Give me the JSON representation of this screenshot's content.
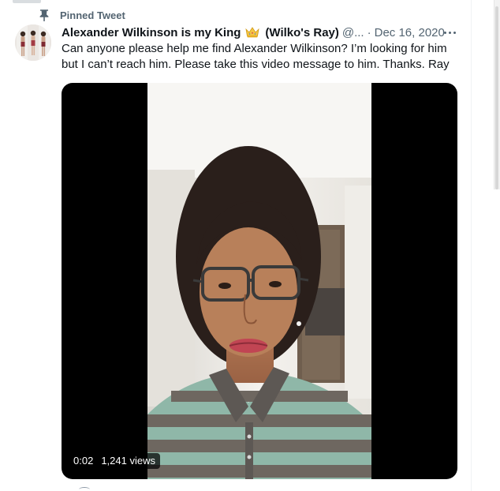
{
  "pinned": {
    "label": "Pinned Tweet",
    "icon": "pin-icon"
  },
  "tweet": {
    "display_name": "Alexander Wilkinson is my King",
    "display_name_emoji": "crown-icon",
    "display_name_tail": "(Wilko's Ray)",
    "handle": "@...",
    "separator": "·",
    "date": "Dec 16, 2020",
    "text_lines": [
      "Can anyone please help me find Alexander Wilkinson? I’m looking for him",
      "but I can’t reach him. Please take this video message to him. Thanks. Ray"
    ],
    "more_icon": "more-horizontal-icon"
  },
  "video": {
    "elapsed": "0:02",
    "views": "1,241 views"
  },
  "colors": {
    "text_primary": "#0f1419",
    "text_secondary": "#536471",
    "divider": "#eff3f4",
    "video_background": "#000000"
  }
}
